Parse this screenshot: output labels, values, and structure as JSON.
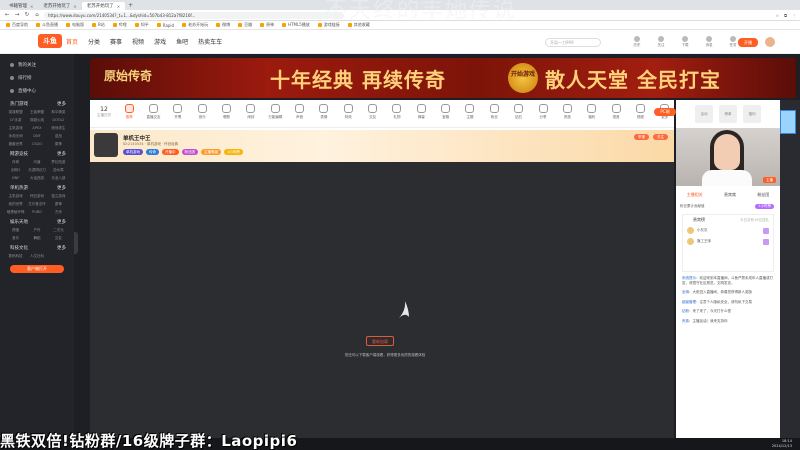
{
  "browser": {
    "tabs": [
      {
        "label": "书籍管理"
      },
      {
        "label": "老苏开始玩了"
      },
      {
        "label": "老苏开始玩了"
      }
    ],
    "new_tab": "+",
    "url": "https://www.douyu.com/2140534?_t=1...&dyshid=507b43-812a7f8216f..."
  },
  "bookmarks": [
    "百度导航",
    "斗鱼直播",
    "电脑版",
    "B站",
    "哔哩",
    "知乎",
    "Rapid",
    "老苏开始玩",
    "微博",
    "豆瓣",
    "原神",
    "HTML5播放",
    "游戏链接",
    "其他收藏"
  ],
  "site": {
    "logo": "斗鱼",
    "nav": [
      {
        "label": "首页",
        "active": true
      },
      {
        "label": "分类"
      },
      {
        "label": "赛事"
      },
      {
        "label": "视频"
      },
      {
        "label": "游戏"
      },
      {
        "label": "鱼吧"
      },
      {
        "label": "热卖车车"
      }
    ],
    "search_placeholder": "开局一刀999",
    "header_icons": [
      "历史",
      "关注",
      "下载",
      "消息",
      "任务"
    ],
    "open_btn": "开播"
  },
  "sidebar": {
    "items": [
      "我的关注",
      "排行榜",
      "直播中心"
    ],
    "sections": [
      {
        "title": "热门游戏",
        "more": "更多",
        "tags": [
          "英雄联盟",
          "王者荣耀",
          "和平精英",
          "CF手游",
          "穿越火线",
          "DOTA2",
          "主机游戏",
          "APEX",
          "绝地求生",
          "永劫无间",
          "DNF",
          "逆战",
          "魔兽世界",
          "CSGO",
          "原神"
        ]
      },
      {
        "title": "网游竞技",
        "more": "更多",
        "tags": [
          "传奇",
          "问道",
          "梦幻西游",
          "剑网3",
          "天涯明月刀",
          "逆水寒",
          "DNF",
          "大话西游",
          "天龙八部"
        ]
      },
      {
        "title": "单机热游",
        "more": "更多",
        "tags": [
          "主机游戏",
          "怀旧游戏",
          "独立游戏",
          "我的世界",
          "艾尔登法环",
          "原神",
          "暗黑破坏神",
          "PUBG",
          "方舟"
        ]
      },
      {
        "title": "娱乐天地",
        "more": "更多",
        "tags": [
          "颜值",
          "户外",
          "二次元",
          "音乐",
          "舞蹈",
          "交友"
        ]
      },
      {
        "title": "科技文化",
        "more": "更多",
        "tags": [
          "数码科技",
          "人文社科"
        ]
      }
    ],
    "open_live_btn": "客户端打开"
  },
  "banner": {
    "logo": "原始传奇",
    "slogan_left": "十年经典 再续传奇",
    "start": "开始游戏",
    "slogan_right": "散人天堂 全民打宝"
  },
  "date_box": {
    "day": "12",
    "label": "主播日历"
  },
  "categories": [
    {
      "label": "推荐",
      "active": true
    },
    {
      "label": "直播交友"
    },
    {
      "label": "开黑"
    },
    {
      "label": "音乐"
    },
    {
      "label": "唱歌"
    },
    {
      "label": "闹钟"
    },
    {
      "label": "万能编辑"
    },
    {
      "label": "声音"
    },
    {
      "label": "表情"
    },
    {
      "label": "特效"
    },
    {
      "label": "交友"
    },
    {
      "label": "礼物"
    },
    {
      "label": "弹幕"
    },
    {
      "label": "宝箱"
    },
    {
      "label": "主题"
    },
    {
      "label": "粉丝"
    },
    {
      "label": "钻石"
    },
    {
      "label": "分享"
    },
    {
      "label": "贵族"
    },
    {
      "label": "福利"
    },
    {
      "label": "语音"
    },
    {
      "label": "视频"
    },
    {
      "label": "更多"
    }
  ],
  "pc_btn": "PC端",
  "room": {
    "title": "单机王中王",
    "sub": "ID:2140534 · 单机游戏 · 怀旧经典",
    "badges": [
      {
        "label": "单机游戏",
        "color": "#5a4fcf"
      },
      {
        "label": "传奇",
        "color": "#2b7bd9"
      },
      {
        "label": "开播中",
        "color": "#ff5d23"
      },
      {
        "label": "粉丝团",
        "color": "#c04fcf"
      },
      {
        "label": "主播等级",
        "color": "#ff9b2c"
      },
      {
        "label": "1小时榜",
        "color": "#f6b40b"
      }
    ],
    "right_chips": [
      "举报",
      "关注"
    ]
  },
  "player": {
    "reload": "重新加载",
    "tip": "您还可以下载客户端观看，获得更多优质的观看体验"
  },
  "right_panel": {
    "top_icons": [
      "活动",
      "榜单",
      "福利"
    ],
    "cam_label": "主播",
    "tabs": [
      {
        "label": "主播相关",
        "active": true
      },
      {
        "label": "贵宾席"
      },
      {
        "label": "粉丝团"
      }
    ],
    "rank_label": "粉丝累计贡献值",
    "rank_badge": "1小时榜",
    "gift_title": "贵宾榜",
    "gift_sub": "今日共有19位送礼",
    "gift_rows": [
      {
        "name": "小灰灰"
      },
      {
        "name": "旗工王帅"
      }
    ],
    "chat": [
      {
        "name": "系统提示",
        "text": "欢迎来到本直播间，斗鱼严禁未成年人直播或打赏，请遵守社区规范，文明发言。"
      },
      {
        "name": "坐骑",
        "text": "大佬进入直播间，恭喜您获得新人奖励"
      },
      {
        "name": "超级管理",
        "text": "注意个人隐私安全，请勿私下交易"
      },
      {
        "name": "钻粉",
        "text": "来了来了，今天打什么怪"
      },
      {
        "name": "贵族",
        "text": "主播加油！我来支持你"
      }
    ]
  },
  "overlay": {
    "watermark": "不天终的丰她传说",
    "text": "黑铁双倍!钻粉群/16级牌子群：Laopipi6"
  },
  "clock": {
    "time": "18:14",
    "date": "2024/12/13"
  }
}
